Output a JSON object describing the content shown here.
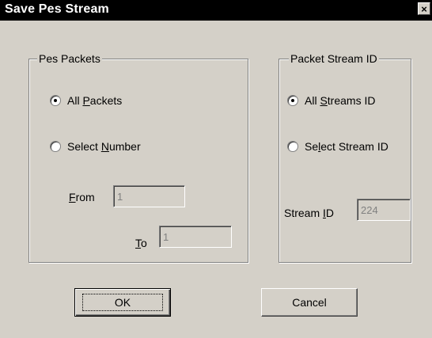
{
  "window": {
    "title": "Save Pes Stream",
    "close_glyph": "×"
  },
  "pes_packets": {
    "legend": "Pes Packets",
    "all_packets": {
      "before": "All ",
      "mnemonic": "P",
      "after": "ackets",
      "checked": true
    },
    "select_number": {
      "before": "Select ",
      "mnemonic": "N",
      "after": "umber",
      "checked": false
    },
    "from": {
      "mnemonic": "F",
      "after": "rom",
      "value": "1"
    },
    "to": {
      "mnemonic": "T",
      "after": "o",
      "value": "1"
    }
  },
  "packet_stream_id": {
    "legend": "Packet Stream ID",
    "all_streams": {
      "before": "All ",
      "mnemonic": "S",
      "after": "treams ID",
      "checked": true
    },
    "select_stream": {
      "before": "Se",
      "mnemonic": "l",
      "after": "ect Stream ID",
      "checked": false
    },
    "stream_id": {
      "before": "Stream ",
      "mnemonic": "I",
      "after": "D",
      "value": "224"
    }
  },
  "buttons": {
    "ok": "OK",
    "cancel": "Cancel"
  }
}
